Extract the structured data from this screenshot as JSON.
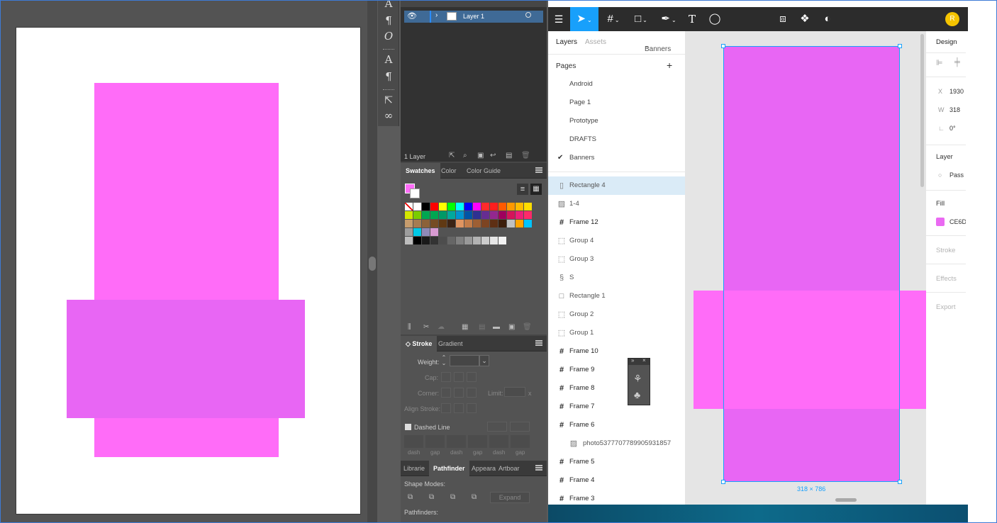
{
  "illustrator": {
    "layers_panel": {
      "layer_name": "Layer 1",
      "layer_count": "1 Layer"
    },
    "swatches_panel": {
      "tabs": [
        "Swatches",
        "Color",
        "Color Guide"
      ],
      "rows": [
        [
          "#ffffff",
          "#ffffff",
          "#000000",
          "#ff0000",
          "#ffff00",
          "#00ff00",
          "#00ffff",
          "#0000ff",
          "#ff00ff",
          "#ff2a2a",
          "#ff1e1e",
          "#ff5a00",
          "#ff9900",
          "#ffbb00",
          "#ffdd00"
        ],
        [
          "#d4e600",
          "#7acc00",
          "#00a651",
          "#00a651",
          "#009966",
          "#00a99d",
          "#0093d0",
          "#0054a6",
          "#2e3192",
          "#662d91",
          "#93278f",
          "#9e005d",
          "#d4145a",
          "#ed1e79",
          "#ff2a6a"
        ],
        [
          "#c69c6d",
          "#a67c52",
          "#8c6239",
          "#754c24",
          "#603913",
          "#3c2415",
          "#e09561",
          "#c37c49",
          "#9e5f34",
          "#7d4422",
          "#5e2f14",
          "#3c1e0b",
          "#c0c0c0",
          "#ffa300",
          "#00c4ff"
        ],
        [
          "#9c9c9c",
          "#00c8e6",
          "#8f8ab8",
          "#d89ad2"
        ],
        [
          "#bdbdbd",
          "#000000",
          "#1a1a1a",
          "#333333",
          "#4d4d4d",
          "#666666",
          "#808080",
          "#999999",
          "#b3b3b3",
          "#cccccc",
          "#e6e6e6",
          "#f2f2f2"
        ]
      ]
    },
    "stroke_panel": {
      "tabs": [
        "Stroke",
        "Gradient"
      ],
      "weight_label": "Weight:",
      "cap_label": "Cap:",
      "corner_label": "Corner:",
      "limit_label": "Limit:",
      "limit_unit": "x",
      "align_label": "Align Stroke:",
      "dashed_line_label": "Dashed Line",
      "dash_labels": [
        "dash",
        "gap",
        "dash",
        "gap",
        "dash",
        "gap"
      ]
    },
    "pathfinder_panel": {
      "tabs": [
        "Librarie",
        "Pathfinder",
        "Appeara",
        "Artboar"
      ],
      "shape_modes_label": "Shape Modes:",
      "expand_label": "Expand",
      "pathfinders_label": "Pathfinders:"
    }
  },
  "figma": {
    "left_tabs": {
      "layers": "Layers",
      "assets": "Assets",
      "current_page": "Banners"
    },
    "pages_title": "Pages",
    "pages": [
      "Android",
      "Page 1",
      "Prototype",
      "DRAFTS",
      "Banners"
    ],
    "layers": [
      {
        "name": "Rectangle 4",
        "icon": "rectangle-icon",
        "glyph": "▯"
      },
      {
        "name": "1-4",
        "icon": "image-icon",
        "glyph": "▨"
      },
      {
        "name": "Frame 12",
        "icon": "frame-icon",
        "glyph": "#"
      },
      {
        "name": "Group 4",
        "icon": "group-icon",
        "glyph": "⬚"
      },
      {
        "name": "Group 3",
        "icon": "group-icon",
        "glyph": "⬚"
      },
      {
        "name": "S",
        "icon": "vector-icon",
        "glyph": "§"
      },
      {
        "name": "Rectangle 1",
        "icon": "rectangle-icon",
        "glyph": "□"
      },
      {
        "name": "Group 2",
        "icon": "group-icon",
        "glyph": "⬚"
      },
      {
        "name": "Group 1",
        "icon": "group-icon",
        "glyph": "⬚"
      },
      {
        "name": "Frame 10",
        "icon": "frame-icon",
        "glyph": "#"
      },
      {
        "name": "Frame 9",
        "icon": "frame-icon",
        "glyph": "#"
      },
      {
        "name": "Frame 8",
        "icon": "frame-icon",
        "glyph": "#"
      },
      {
        "name": "Frame 7",
        "icon": "frame-icon",
        "glyph": "#"
      },
      {
        "name": "Frame 6",
        "icon": "frame-icon",
        "glyph": "#"
      },
      {
        "name": "photo5377707789905931857",
        "icon": "image-icon",
        "glyph": "▨"
      },
      {
        "name": "Frame 5",
        "icon": "frame-icon",
        "glyph": "#"
      },
      {
        "name": "Frame 4",
        "icon": "frame-icon",
        "glyph": "#"
      },
      {
        "name": "Frame 3",
        "icon": "frame-icon",
        "glyph": "#"
      }
    ],
    "selection_size": "318 × 786",
    "design_panel": {
      "title": "Design",
      "x_label": "X",
      "x_value": "1930",
      "w_label": "W",
      "w_value": "318",
      "rotation_value": "0°",
      "layer_title": "Layer",
      "blend_value": "Pass",
      "fill_title": "Fill",
      "fill_hex": "CE6D",
      "fill_color": "#ea6af2",
      "stroke_title": "Stroke",
      "effects_title": "Effects",
      "export_title": "Export"
    },
    "avatar_initial": "R",
    "accent": "#18a0fb"
  },
  "colors": {
    "pink_light": "#ff6cf8",
    "pink_mid": "#e866f4"
  }
}
